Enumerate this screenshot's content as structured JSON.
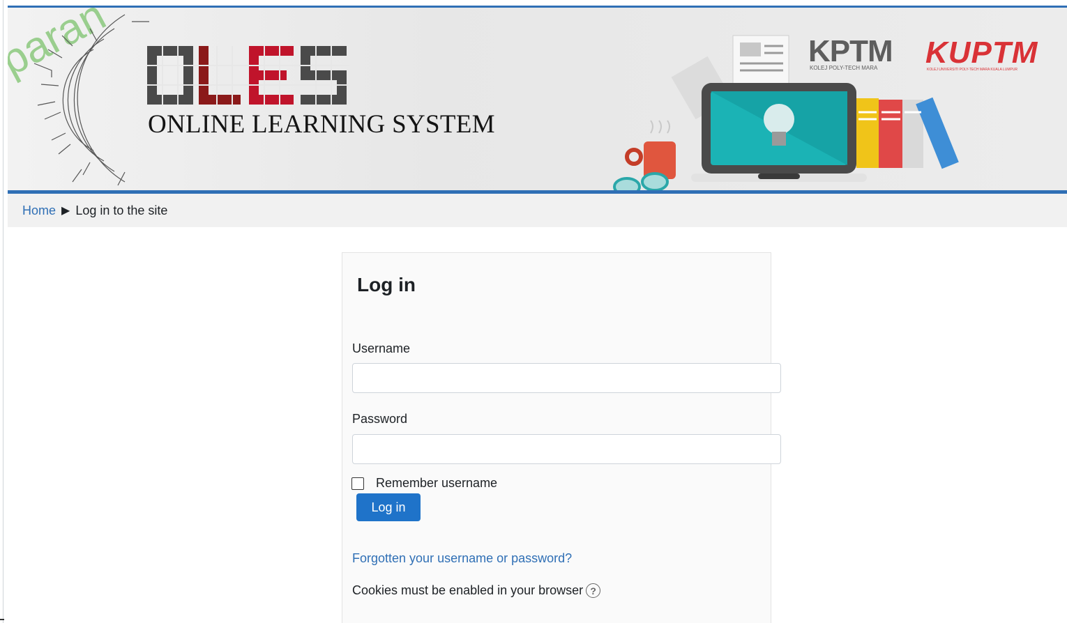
{
  "banner": {
    "watermark": "paran",
    "logo_text": "OLES",
    "system_title": "ONLINE LEARNING SYSTEM",
    "kptm_logo": "KPTM",
    "kptm_subtitle": "KOLEJ POLY-TECH MARA",
    "kuptm_logo": "KUPTM",
    "kuptm_subtitle": "KOLEJ UNIVERSITI POLY-TECH MARA KUALA LUMPUR"
  },
  "breadcrumb": {
    "home": "Home",
    "separator": "▶",
    "current": "Log in to the site"
  },
  "login": {
    "title": "Log in",
    "username_label": "Username",
    "username_value": "",
    "password_label": "Password",
    "password_value": "",
    "remember_label": "Remember username",
    "remember_checked": false,
    "submit_label": "Log in",
    "forgot_link": "Forgotten your username or password?",
    "cookies_note": "Cookies must be enabled in your browser",
    "help_icon": "question-circle-icon"
  },
  "colors": {
    "accent": "#2f6fb5",
    "button": "#1f73c9",
    "kuptm_red": "#d93236",
    "oles_dark": "#4a4a4a",
    "oles_red": "#8b1a1a"
  }
}
